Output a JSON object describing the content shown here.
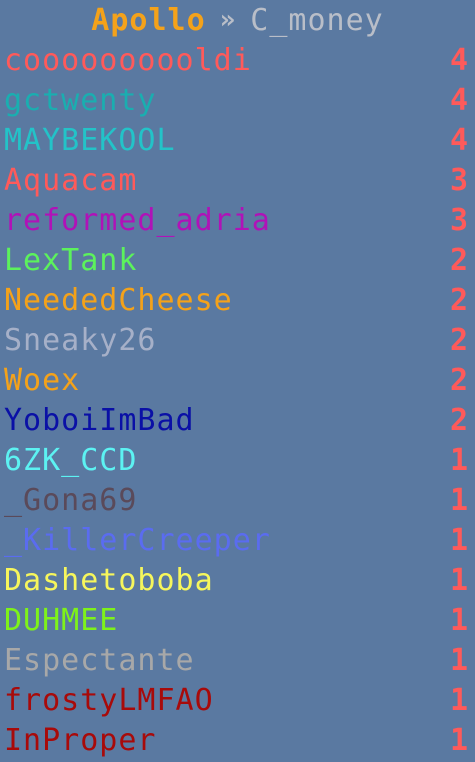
{
  "header": {
    "server": "Apollo",
    "separator": "»",
    "user": "C_money"
  },
  "colors": {
    "background": "#5a79a1",
    "score": "#ff5a5a"
  },
  "players": [
    {
      "name": "coooooooooldi",
      "score": "4",
      "color": "#ff5a5a"
    },
    {
      "name": "gctwenty",
      "score": "4",
      "color": "#1aaeb0"
    },
    {
      "name": "MAYBEKOOL",
      "score": "4",
      "color": "#23c3c8"
    },
    {
      "name": "Aquacam",
      "score": "3",
      "color": "#ff5a5a"
    },
    {
      "name": "reformed_adria",
      "score": "3",
      "color": "#b012b8"
    },
    {
      "name": "LexTank",
      "score": "2",
      "color": "#5cf25c"
    },
    {
      "name": "NeededCheese",
      "score": "2",
      "color": "#f4a21a"
    },
    {
      "name": "Sneaky26",
      "score": "2",
      "color": "#a6b0c8"
    },
    {
      "name": "Woex",
      "score": "2",
      "color": "#f4a21a"
    },
    {
      "name": "YoboiImBad",
      "score": "2",
      "color": "#0a10a6"
    },
    {
      "name": "6ZK_CCD",
      "score": "1",
      "color": "#5cf2f2"
    },
    {
      "name": "_Gona69",
      "score": "1",
      "color": "#5a4a5a"
    },
    {
      "name": "_KillerCreeper",
      "score": "1",
      "color": "#5a6cf0"
    },
    {
      "name": "Dashetoboba",
      "score": "1",
      "color": "#f6f65c"
    },
    {
      "name": "DUHMEE",
      "score": "1",
      "color": "#7ef21a"
    },
    {
      "name": "Espectante",
      "score": "1",
      "color": "#a8a8a8"
    },
    {
      "name": "frostyLMFAO",
      "score": "1",
      "color": "#a80a0a"
    },
    {
      "name": "InProper",
      "score": "1",
      "color": "#a80a0a"
    }
  ]
}
